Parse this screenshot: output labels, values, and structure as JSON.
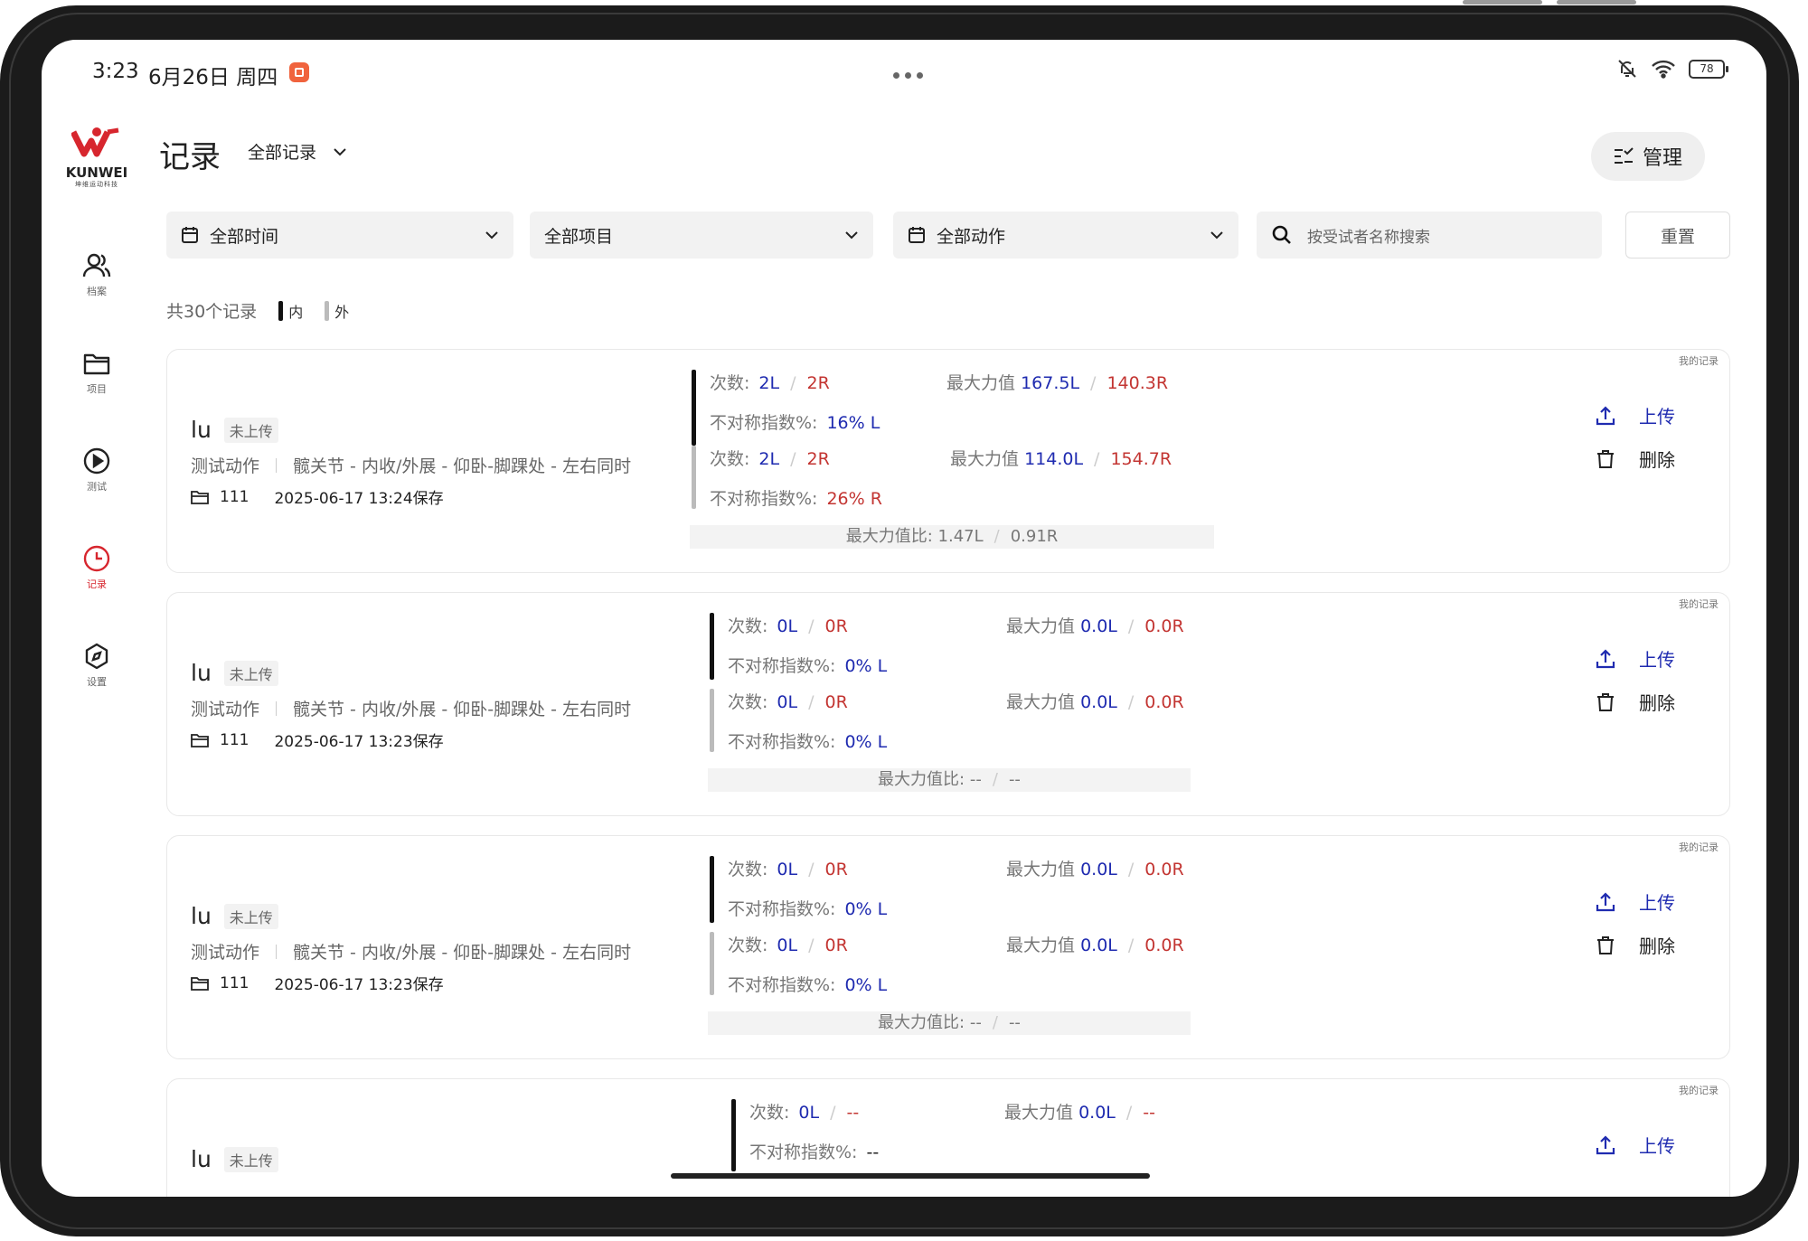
{
  "status_bar": {
    "time": "3:23",
    "date": "6月26日 周四",
    "battery": "78"
  },
  "logo": {
    "name": "KUNWEI",
    "subtitle": "坤维运动科技"
  },
  "sidebar": {
    "items": [
      {
        "label": "档案",
        "icon": "users-icon"
      },
      {
        "label": "项目",
        "icon": "folder-icon"
      },
      {
        "label": "测试",
        "icon": "play-icon"
      },
      {
        "label": "记录",
        "icon": "clock-icon",
        "active": true
      },
      {
        "label": "设置",
        "icon": "compass-icon"
      }
    ]
  },
  "header": {
    "title": "记录",
    "scope": "全部记录",
    "manage_label": "管理"
  },
  "filters": {
    "time": "全部时间",
    "project": "全部项目",
    "action": "全部动作",
    "search_placeholder": "按受试者名称搜索",
    "reset_label": "重置"
  },
  "summary": {
    "count_text": "共30个记录",
    "legend_inner": "内",
    "legend_outer": "外"
  },
  "labels": {
    "my_record": "我的记录",
    "count": "次数:",
    "asym": "不对称指数%:",
    "max_force": "最大力值",
    "ratio": "最大力值比:",
    "upload": "上传",
    "delete": "删除"
  },
  "records": [
    {
      "name": "lu",
      "status": "未上传",
      "action_label": "测试动作",
      "action": "髋关节 - 内收/外展 - 仰卧-脚踝处 - 左右同时",
      "project": "111",
      "saved": "2025-06-17 13:24保存",
      "inner": {
        "count_l": "2L",
        "count_r": "2R",
        "max_l": "167.5L",
        "max_r": "140.3R",
        "asym_val": "16% L"
      },
      "outer": {
        "count_l": "2L",
        "count_r": "2R",
        "max_l": "114.0L",
        "max_r": "154.7R",
        "asym_val": "26% R"
      },
      "ratio_l": "1.47L",
      "ratio_r": "0.91R"
    },
    {
      "name": "lu",
      "status": "未上传",
      "action_label": "测试动作",
      "action": "髋关节 - 内收/外展 - 仰卧-脚踝处 - 左右同时",
      "project": "111",
      "saved": "2025-06-17 13:23保存",
      "inner": {
        "count_l": "0L",
        "count_r": "0R",
        "max_l": "0.0L",
        "max_r": "0.0R",
        "asym_val": "0% L"
      },
      "outer": {
        "count_l": "0L",
        "count_r": "0R",
        "max_l": "0.0L",
        "max_r": "0.0R",
        "asym_val": "0% L"
      },
      "ratio_l": "--",
      "ratio_r": "--"
    },
    {
      "name": "lu",
      "status": "未上传",
      "action_label": "测试动作",
      "action": "髋关节 - 内收/外展 - 仰卧-脚踝处 - 左右同时",
      "project": "111",
      "saved": "2025-06-17 13:23保存",
      "inner": {
        "count_l": "0L",
        "count_r": "0R",
        "max_l": "0.0L",
        "max_r": "0.0R",
        "asym_val": "0% L"
      },
      "outer": {
        "count_l": "0L",
        "count_r": "0R",
        "max_l": "0.0L",
        "max_r": "0.0R",
        "asym_val": "0% L"
      },
      "ratio_l": "--",
      "ratio_r": "--"
    },
    {
      "name": "lu",
      "status": "未上传",
      "inner": {
        "count_l": "0L",
        "count_r": "--",
        "max_l": "0.0L",
        "max_r": "--",
        "asym_val": "--"
      }
    }
  ],
  "colors": {
    "accent": "#1f2bb0",
    "right": "#c33532",
    "brand": "#d7262e"
  }
}
